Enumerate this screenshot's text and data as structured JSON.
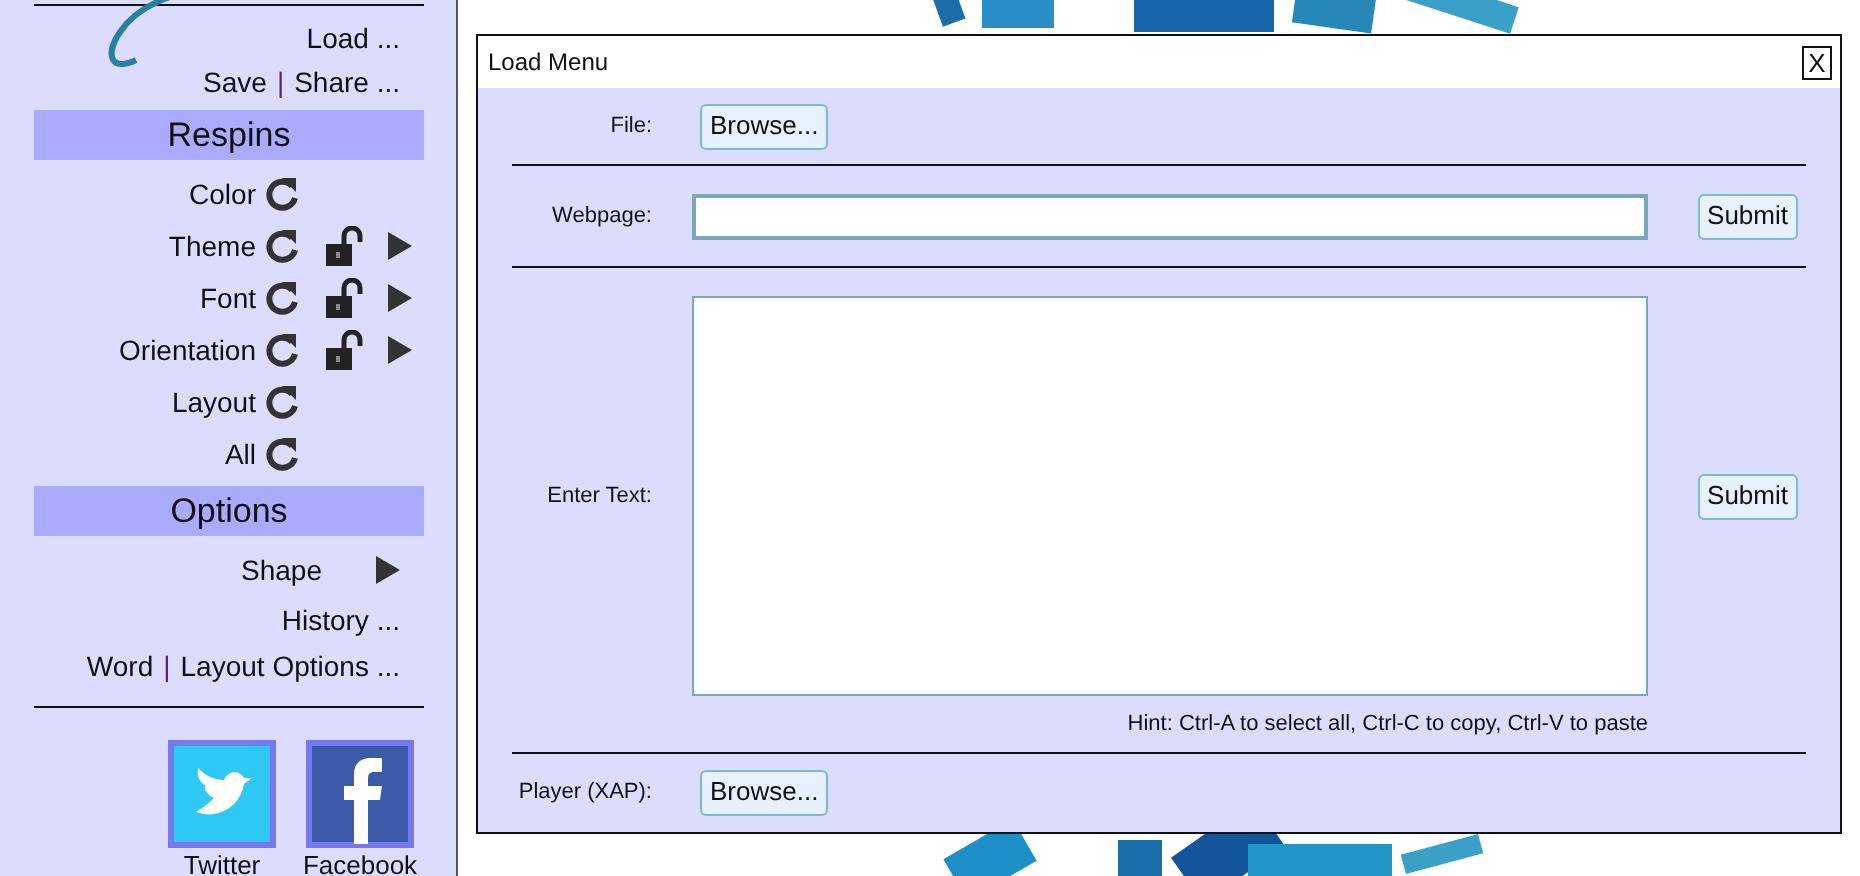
{
  "sidebar": {
    "separator": "|",
    "top_links": [
      {
        "links": [
          "Load ..."
        ]
      },
      {
        "links": [
          "Save",
          "Share ..."
        ]
      }
    ],
    "sections": [
      {
        "title": "Respins",
        "items": [
          {
            "label": "Color",
            "kind": "respin"
          },
          {
            "label": "Theme",
            "kind": "respin_lockable",
            "locked": false
          },
          {
            "label": "Font",
            "kind": "respin_lockable",
            "locked": false
          },
          {
            "label": "Orientation",
            "kind": "respin_lockable",
            "locked": false
          },
          {
            "label": "Layout",
            "kind": "respin"
          },
          {
            "label": "All",
            "kind": "respin"
          }
        ]
      },
      {
        "title": "Options",
        "items": [
          {
            "label": "Shape",
            "kind": "submenu"
          },
          {
            "label": "History ...",
            "kind": "link"
          },
          {
            "links": [
              "Word",
              "Layout Options ..."
            ],
            "kind": "links"
          }
        ]
      }
    ],
    "social": [
      {
        "kind": "twitter",
        "label": "Twitter"
      },
      {
        "kind": "facebook",
        "label": "Facebook"
      }
    ]
  },
  "dialog": {
    "title": "Load Menu",
    "close": "X",
    "rows": [
      {
        "kind": "file",
        "label": "File:",
        "button": "Browse..."
      },
      {
        "kind": "url",
        "label": "Webpage:",
        "value": "",
        "submit": "Submit"
      },
      {
        "kind": "text",
        "label": "Enter Text:",
        "submit": "Submit",
        "hint": "Hint: Ctrl-A to select all, Ctrl-C to copy, Ctrl-V to paste"
      },
      {
        "kind": "file",
        "label": "Player (XAP):",
        "button": "Browse..."
      }
    ]
  }
}
